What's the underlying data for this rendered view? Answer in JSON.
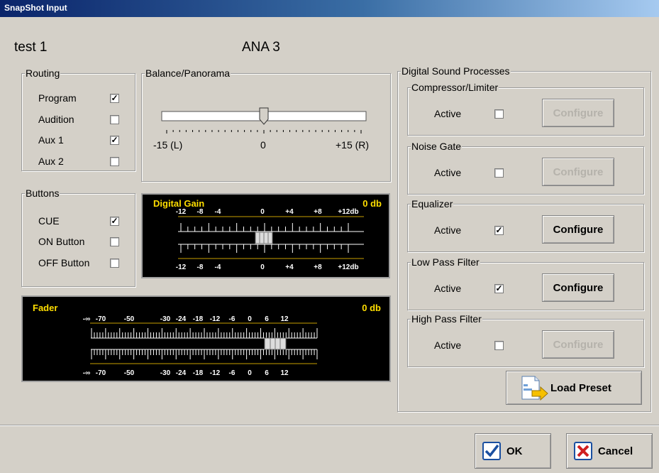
{
  "window": {
    "title": "SnapShot Input"
  },
  "header": {
    "name": "test 1",
    "source": "ANA 3"
  },
  "routing": {
    "legend": "Routing",
    "items": [
      {
        "label": "Program",
        "checked": true
      },
      {
        "label": "Audition",
        "checked": false
      },
      {
        "label": "Aux 1",
        "checked": true
      },
      {
        "label": "Aux 2",
        "checked": false
      }
    ]
  },
  "balance": {
    "legend": "Balance/Panorama",
    "left_label": "-15 (L)",
    "center_label": "0",
    "right_label": "+15 (R)",
    "value": 0
  },
  "buttons": {
    "legend": "Buttons",
    "items": [
      {
        "label": "CUE",
        "checked": true
      },
      {
        "label": "ON Button",
        "checked": false
      },
      {
        "label": "OFF Button",
        "checked": false
      }
    ]
  },
  "digital_gain": {
    "title": "Digital Gain",
    "value": "0 db",
    "ticks": [
      "-12",
      "-8",
      "-4",
      "0",
      "+4",
      "+8",
      "+12db"
    ]
  },
  "fader": {
    "title": "Fader",
    "value": "0 db",
    "ticks": [
      "-∞",
      "-70",
      "-50",
      "-30",
      "-24",
      "-18",
      "-12",
      "-6",
      "0",
      "6",
      "12"
    ]
  },
  "dsp": {
    "legend": "Digital Sound Processes",
    "active_label": "Active",
    "configure_label": "Configure",
    "sections": [
      {
        "legend": "Compressor/Limiter",
        "active": false,
        "configure_enabled": false
      },
      {
        "legend": "Noise Gate",
        "active": false,
        "configure_enabled": false
      },
      {
        "legend": "Equalizer",
        "active": true,
        "configure_enabled": true
      },
      {
        "legend": "Low Pass Filter",
        "active": true,
        "configure_enabled": true
      },
      {
        "legend": "High Pass Filter",
        "active": false,
        "configure_enabled": false
      }
    ],
    "load_preset_label": "Load Preset"
  },
  "footer": {
    "ok_label": "OK",
    "cancel_label": "Cancel"
  },
  "colors": {
    "panel_bg": "#000000",
    "accent_yellow": "#ffde00",
    "title_bar": "#0a246a"
  }
}
